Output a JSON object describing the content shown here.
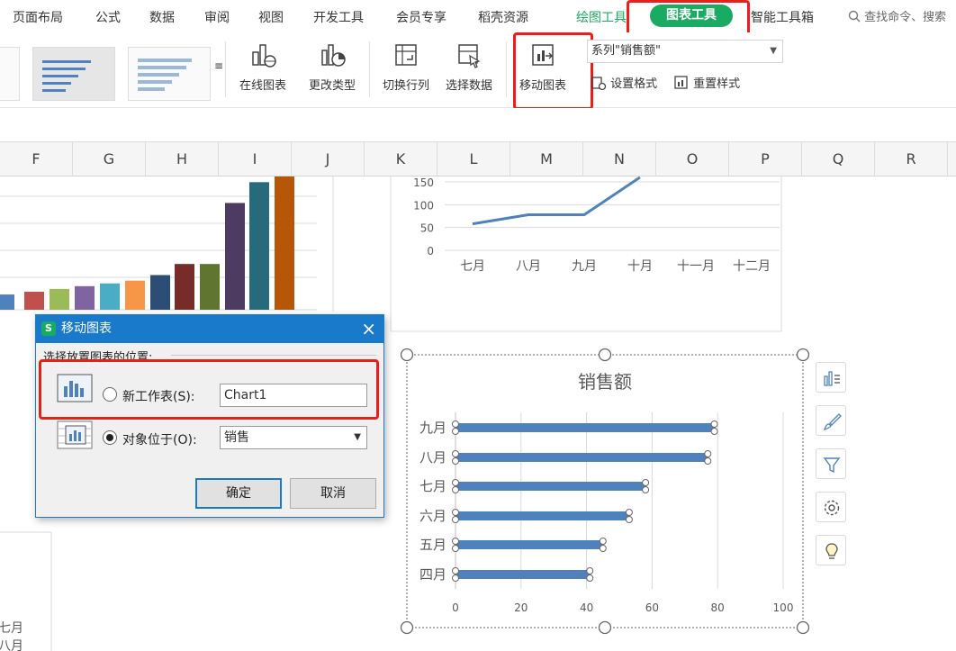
{
  "menu": {
    "items": [
      "页面布局",
      "公式",
      "数据",
      "审阅",
      "视图",
      "开发工具",
      "会员专享",
      "稻壳资源"
    ],
    "draw_tools": "绘图工具",
    "chart_tools": "图表工具",
    "smart_tools": "智能工具箱",
    "search": "查找命令、搜索"
  },
  "ribbon": {
    "online_chart": "在线图表",
    "change_type": "更改类型",
    "switch_row_col": "切换行列",
    "select_data": "选择数据",
    "move_chart": "移动图表",
    "series_value": "系列\"销售额\"",
    "set_format": "设置格式",
    "reset_style": "重置样式"
  },
  "columns": [
    "F",
    "G",
    "H",
    "I",
    "J",
    "K",
    "L",
    "M",
    "N",
    "O",
    "P",
    "Q",
    "R"
  ],
  "dialog": {
    "title": "移动图表",
    "group_label": "选择放置图表的位置:",
    "new_sheet_label": "新工作表(S):",
    "new_sheet_value": "Chart1",
    "object_in_label": "对象位于(O):",
    "object_in_value": "销售",
    "ok": "确定",
    "cancel": "取消"
  },
  "left_chart_cropped": {
    "bar_colors": [
      "#4f81bd",
      "#c0504d",
      "#9bbb59",
      "#8064a2",
      "#4bacc6",
      "#f79646",
      "#2c4d75",
      "#772c2a",
      "#5f7530",
      "#4d3b62",
      "#276a7c",
      "#b65708"
    ],
    "heights_rel": [
      0.11,
      0.13,
      0.15,
      0.17,
      0.19,
      0.21,
      0.25,
      0.33,
      0.33,
      0.77,
      0.92,
      1.0
    ]
  },
  "chart_data": [
    {
      "type": "line",
      "title": "",
      "categories": [
        "七月",
        "八月",
        "九月",
        "十月",
        "十一月",
        "十二月"
      ],
      "series": [
        {
          "values": [
            58,
            78,
            78,
            160,
            null,
            null
          ]
        }
      ],
      "ylim": [
        0,
        150
      ],
      "yticks": [
        "0",
        "50",
        "100",
        "150"
      ],
      "color": "#4f81bd",
      "grid": true
    },
    {
      "type": "bar",
      "orientation": "horizontal",
      "title": "销售额",
      "categories": [
        "九月",
        "八月",
        "七月",
        "六月",
        "五月",
        "四月"
      ],
      "values": [
        79,
        77,
        58,
        53,
        45,
        41
      ],
      "xlim": [
        0,
        100
      ],
      "xticks": [
        "0",
        "20",
        "40",
        "60",
        "80",
        "100"
      ],
      "color": "#4f81bd",
      "grid": true
    }
  ],
  "left_bottom_labels": [
    "七月",
    "八月"
  ]
}
